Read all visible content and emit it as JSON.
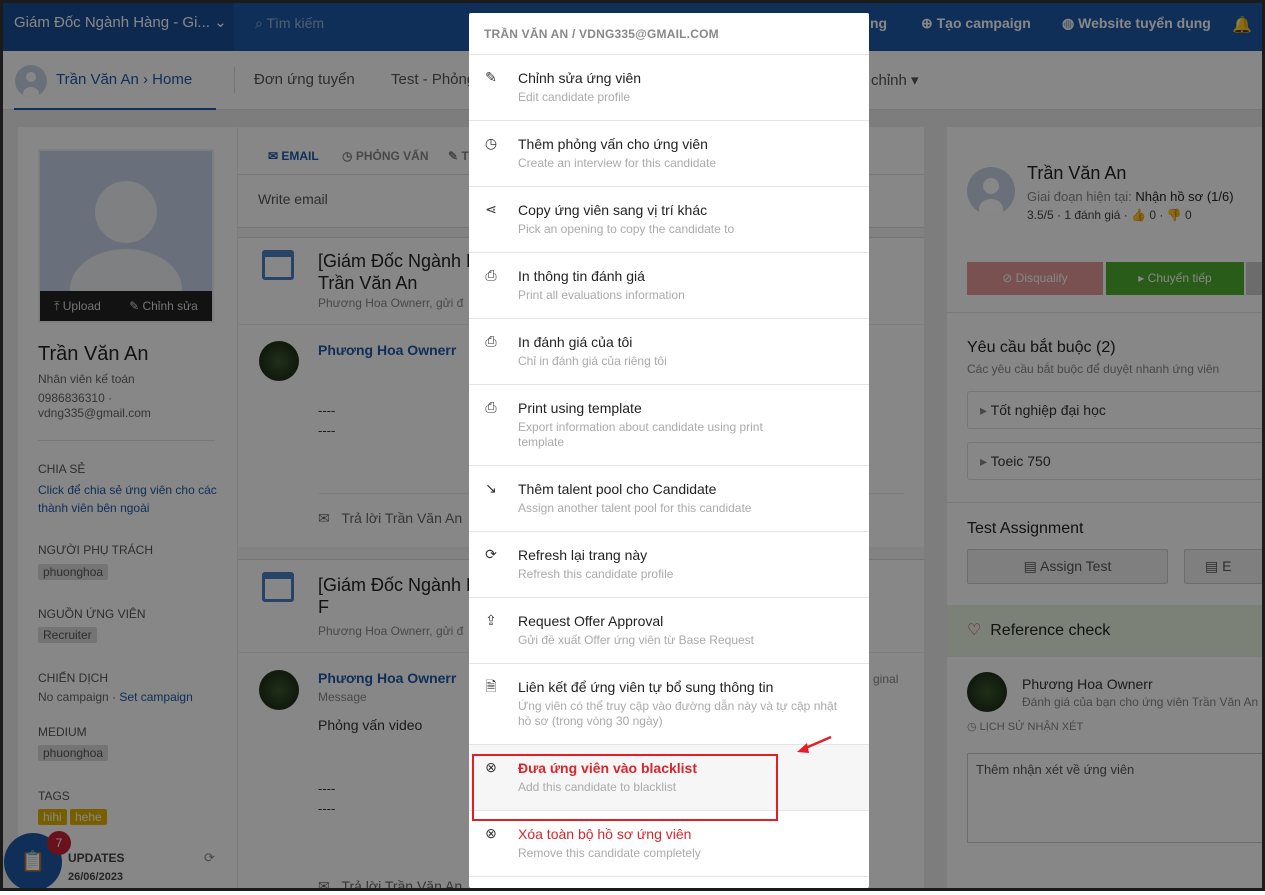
{
  "topbar": {
    "job_selector": "Giám Đốc Ngành Hàng - Gi...",
    "search_placeholder": "Tìm kiếm",
    "partial_link": "ng",
    "create_campaign": "Tạo campaign",
    "career_site": "Website tuyển dụng"
  },
  "subnav": {
    "breadcrumb": "Trần Văn An › Home",
    "tabs": [
      "Đơn ứng tuyển",
      "Test - Phỏng",
      "chỉnh"
    ]
  },
  "left": {
    "upload": "Upload",
    "edit": "Chỉnh sửa",
    "name": "Trần Văn An",
    "title": "Nhân viên kế toán",
    "phone": "0986836310 ·",
    "email": "vdng335@gmail.com",
    "share_label": "CHIA SẺ",
    "share_link": "Click để chia sẻ ứng viên cho các thành viên bên ngoài",
    "owner_label": "NGƯỜI PHỤ TRÁCH",
    "owner_tag": "phuonghoa",
    "source_label": "NGUỒN ỨNG VIÊN",
    "source_tag": "Recruiter",
    "campaign_label": "CHIẾN DỊCH",
    "campaign_text": "No campaign ·",
    "campaign_link": "Set campaign",
    "medium_label": "MEDIUM",
    "medium_tag": "phuonghoa",
    "tags_label": "TAGS",
    "tags": [
      "hihi",
      "hehe"
    ],
    "updates_label": "UPDATES",
    "updates_date": "26/06/2023",
    "fab_badge": "7"
  },
  "middle": {
    "tabs": [
      "EMAIL",
      "PHỎNG VẤN",
      "T"
    ],
    "compose": "Write email",
    "card1": {
      "title": "[Giám Đốc Ngành H\nTrần Văn An",
      "sub": "Phương Hoa Ownerr, gửi đ",
      "sender": "Phương Hoa Ownerr",
      "dash1": "----",
      "dash2": "----",
      "reply": "Trả lời Trần Văn An"
    },
    "card2": {
      "title": "[Giám Đốc Ngành H\nF",
      "sub": "Phương Hoa Ownerr, gửi đ",
      "sender": "Phương Hoa Ownerr",
      "message_label": "Message",
      "original": "ginal",
      "body": "Phỏng vấn video",
      "dash1": "----",
      "dash2": "----",
      "reply": "Trả lời Trần Văn An"
    }
  },
  "right": {
    "name": "Trần Văn An",
    "stage_label": "Giai đoạn hiện tại:",
    "stage_value": "Nhận hồ sơ (1/6)",
    "rating": "3.5/5 · 1 đánh giá · 👍 0 · 👎 0",
    "disqualify": "Disqualify",
    "next": "Chuyển tiếp",
    "req_title": "Yêu cầu bắt buộc (2)",
    "req_sub": "Các yêu cầu bắt buộc để duyệt nhanh ứng viên",
    "requirements": [
      "Tốt nghiệp đại học",
      "Toeic 750"
    ],
    "test_title": "Test Assignment",
    "assign_test": "Assign Test",
    "ex": "E",
    "ref_title": "Reference check",
    "ref_person": "Phương Hoa Ownerr",
    "ref_desc": "Đánh giá của bạn cho ứng viên Trần Văn An",
    "history": "LỊCH SỬ NHẬN XÉT",
    "comment_placeholder": "Thêm nhận xét về ứng viên"
  },
  "menu": {
    "header": "TRẦN VĂN AN / VDNG335@GMAIL.COM",
    "items": [
      {
        "title": "Chỉnh sửa ứng viên",
        "sub": "Edit candidate profile",
        "icon": "pencil-icon"
      },
      {
        "title": "Thêm phỏng vấn cho ứng viên",
        "sub": "Create an interview for this candidate",
        "icon": "clock-icon"
      },
      {
        "title": "Copy ứng viên sang vị trí khác",
        "sub": "Pick an opening to copy the candidate to",
        "icon": "share-icon"
      },
      {
        "title": "In thông tin đánh giá",
        "sub": "Print all evaluations information",
        "icon": "printer-icon"
      },
      {
        "title": "In đánh giá của tôi",
        "sub": "Chỉ in đánh giá của riêng tôi",
        "icon": "printer-icon"
      },
      {
        "title": "Print using template",
        "sub": "Export information about candidate using print template",
        "icon": "printer-icon"
      },
      {
        "title": "Thêm talent pool cho Candidate",
        "sub": "Assign another talent pool for this candidate",
        "icon": "trend-icon"
      },
      {
        "title": "Refresh lại trang này",
        "sub": "Refresh this candidate profile",
        "icon": "refresh-icon"
      },
      {
        "title": "Request Offer Approval",
        "sub": "Gửi đề xuất Offer ứng viên từ Base Request",
        "icon": "export-icon"
      },
      {
        "title": "Liên kết để ứng viên tự bổ sung thông tin",
        "sub": "Ứng viên có thể truy cập vào đường dẫn này và tự cập nhật hồ sơ (trong vòng 30 ngày)",
        "icon": "file-add-icon"
      },
      {
        "title": "Đưa ứng viên vào blacklist",
        "sub": "Add this candidate to blacklist",
        "icon": "x-circle-icon"
      },
      {
        "title": "Xóa toàn bộ hồ sơ ứng viên",
        "sub": "Remove this candidate completely",
        "icon": "x-circle-icon"
      }
    ]
  }
}
